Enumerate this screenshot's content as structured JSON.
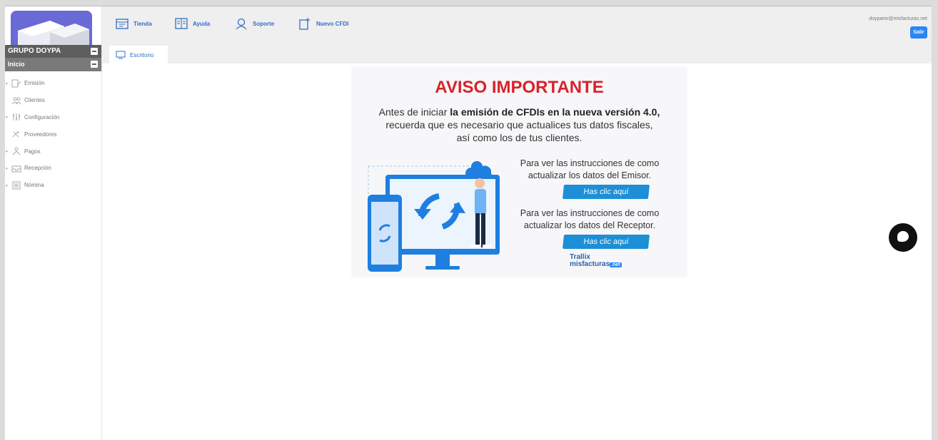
{
  "sidebar": {
    "company_name": "GRUPO DOYPA",
    "home_label": "Inicio",
    "items": [
      {
        "label": "Emisión",
        "icon": "document-edit-icon"
      },
      {
        "label": "Clientes",
        "icon": "users-icon"
      },
      {
        "label": "Configuración",
        "icon": "settings-icon"
      },
      {
        "label": "Proveedores",
        "icon": "tools-icon"
      },
      {
        "label": "Pagos",
        "icon": "payments-icon"
      },
      {
        "label": "Recepción",
        "icon": "inbox-icon"
      },
      {
        "label": "Nómina",
        "icon": "payroll-icon"
      }
    ]
  },
  "topbar": {
    "nav": [
      {
        "label": "Tienda",
        "icon": "store-icon"
      },
      {
        "label": "Ayuda",
        "icon": "help-book-icon"
      },
      {
        "label": "Soporte",
        "icon": "support-agent-icon"
      },
      {
        "label": "Nuevo CFDI",
        "icon": "new-document-icon"
      }
    ],
    "user_email": "doypamr@misfacturas.net",
    "exit_label": "Salir"
  },
  "tab": {
    "label": "Escritorio"
  },
  "banner": {
    "title": "AVISO IMPORTANTE",
    "intro_prefix": "Antes de iniciar ",
    "intro_bold": "la emisión de CFDIs en la nueva versión 4.0,",
    "intro_rest_1": "recuerda que es necesario que actualices tus datos fiscales,",
    "intro_rest_2": "así como los de tus clientes.",
    "emisor_line1": "Para ver las instrucciones de como",
    "emisor_line2": "actualizar los datos del Emisor.",
    "emisor_button": "Has clic aquí",
    "receptor_line1": "Para ver las instrucciones de como",
    "receptor_line2": "actualizar los datos del Receptor.",
    "receptor_button": "Has clic aquí",
    "brand_line1": "Trallix",
    "brand_line2": "misfacturas",
    "brand_net": ".net"
  },
  "colors": {
    "accent": "#2a86f3",
    "title_red": "#d8222b",
    "button_blue": "#1c8fd6"
  }
}
